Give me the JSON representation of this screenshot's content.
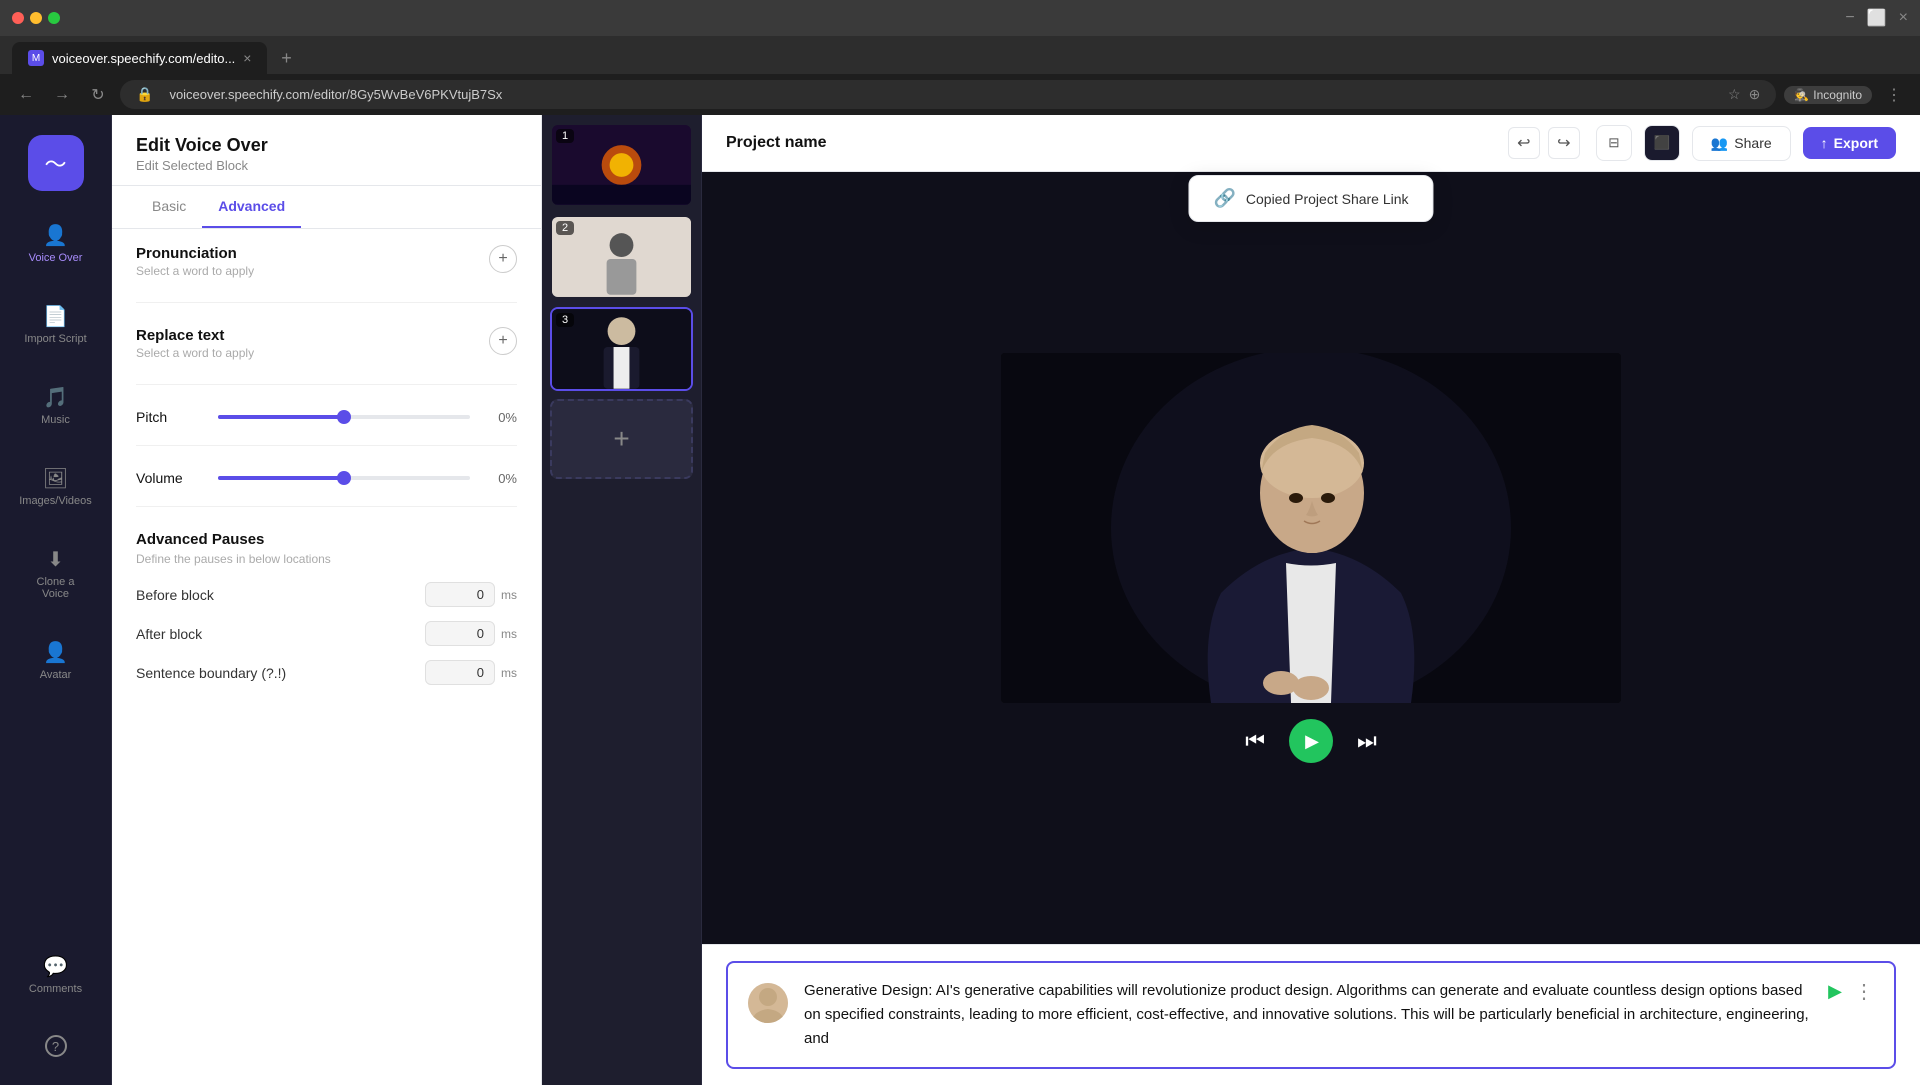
{
  "browser": {
    "tab_favicon": "M",
    "tab_title": "voiceover.speechify.com/edito...",
    "tab_close": "×",
    "new_tab": "+",
    "nav_back": "←",
    "nav_forward": "→",
    "nav_refresh": "↻",
    "address_url": "voiceover.speechify.com/editor/8Gy5WvBeV6PKVtujB7Sx",
    "incognito_label": "Incognito",
    "window_min": "−",
    "window_restore": "⬜",
    "window_close": "×"
  },
  "brand_sidebar": {
    "logo_icon": "〜",
    "nav_items": [
      {
        "id": "voice-over",
        "icon": "👤",
        "label": "Voice Over",
        "active": true
      },
      {
        "id": "import-script",
        "icon": "📄",
        "label": "Import Script"
      },
      {
        "id": "music",
        "icon": "🎵",
        "label": "Music"
      },
      {
        "id": "images-videos",
        "icon": "🖼",
        "label": "Images/Videos"
      },
      {
        "id": "clone-voice",
        "icon": "⬇",
        "label": "Clone a Voice"
      },
      {
        "id": "avatar",
        "icon": "👤",
        "label": "Avatar"
      },
      {
        "id": "comments",
        "icon": "💬",
        "label": "Comments"
      },
      {
        "id": "help",
        "icon": "?",
        "label": "Help"
      }
    ]
  },
  "edit_panel": {
    "title": "Edit Voice Over",
    "subtitle": "Edit Selected Block",
    "tabs": [
      {
        "id": "basic",
        "label": "Basic"
      },
      {
        "id": "advanced",
        "label": "Advanced",
        "active": true
      }
    ],
    "pronunciation": {
      "title": "Pronunciation",
      "subtitle": "Select a word to apply"
    },
    "replace_text": {
      "title": "Replace text",
      "subtitle": "Select a word to apply"
    },
    "pitch": {
      "label": "Pitch",
      "value": "0%",
      "percent": 50
    },
    "volume": {
      "label": "Volume",
      "value": "0%",
      "percent": 50
    },
    "advanced_pauses": {
      "title": "Advanced Pauses",
      "subtitle": "Define the pauses in below locations",
      "before_block": {
        "label": "Before block",
        "value": "0",
        "unit": "ms"
      },
      "after_block": {
        "label": "After block",
        "value": "0",
        "unit": "ms"
      },
      "sentence_boundary": {
        "label": "Sentence boundary (?.!)",
        "value": "0",
        "unit": "ms"
      }
    }
  },
  "slides": [
    {
      "number": "1",
      "active": false,
      "bg": "slide-1-bg"
    },
    {
      "number": "2",
      "active": false,
      "bg": "slide-2-bg"
    },
    {
      "number": "3",
      "active": true,
      "bg": "slide-3-bg"
    }
  ],
  "slide_add_label": "+",
  "top_bar": {
    "project_name": "Project name",
    "undo_icon": "↩",
    "redo_icon": "↪",
    "layers_icon": "⊟",
    "preview_icon": "⬛",
    "share_label": "Share",
    "share_icon": "👥",
    "export_label": "Export",
    "export_icon": "↑"
  },
  "copied_toast": {
    "icon": "🔗",
    "text": "Copied Project Share Link"
  },
  "video_controls": {
    "rewind_icon": "⏮",
    "play_icon": "▶",
    "forward_icon": "⏭"
  },
  "script": {
    "text": "Generative Design: AI's generative capabilities will revolutionize product design. Algorithms can generate and evaluate countless design options based on specified constraints, leading to more efficient, cost-effective, and innovative solutions. This will be particularly beneficial in architecture, engineering, and",
    "play_icon": "▶",
    "more_icon": "⋮"
  }
}
